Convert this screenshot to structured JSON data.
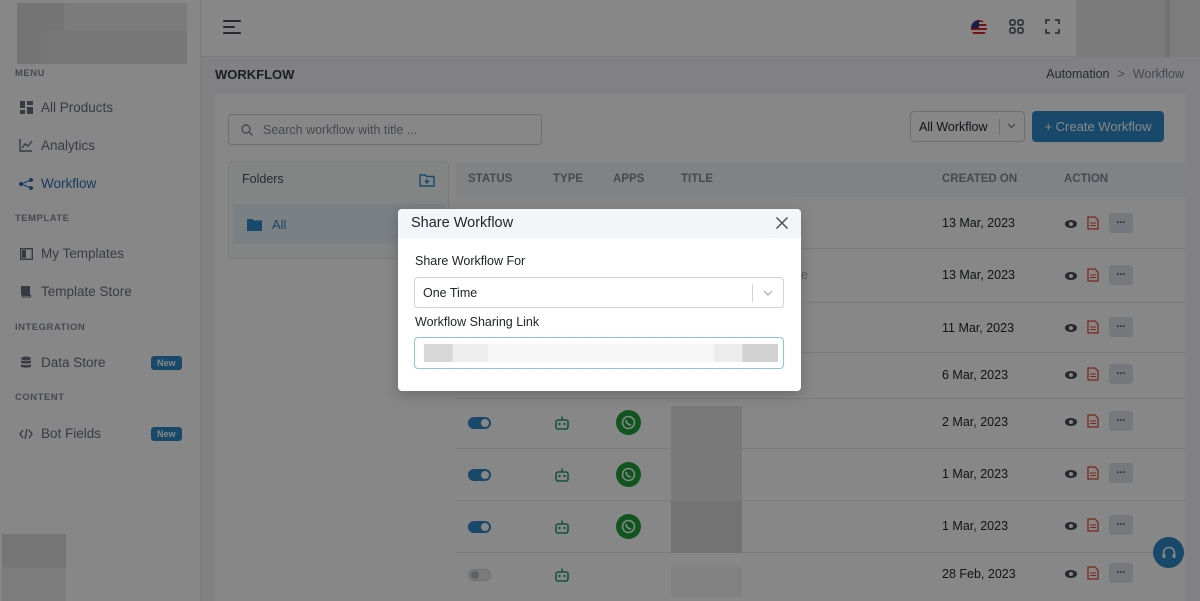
{
  "sidebar": {
    "sections": {
      "menu": "MENU",
      "template": "TEMPLATE",
      "integration": "INTEGRATION",
      "content": "CONTENT"
    },
    "items": [
      {
        "label": "All Products",
        "icon": "grid-icon"
      },
      {
        "label": "Analytics",
        "icon": "line-chart-icon"
      },
      {
        "label": "Workflow",
        "icon": "share-nodes-icon",
        "active": true
      },
      {
        "label": "My Templates",
        "icon": "layout-icon"
      },
      {
        "label": "Template Store",
        "icon": "book-icon"
      },
      {
        "label": "Data Store",
        "icon": "database-icon",
        "badge": "New"
      },
      {
        "label": "Bot Fields",
        "icon": "code-icon",
        "badge": "New"
      }
    ]
  },
  "header": {
    "page_title": "WORKFLOW",
    "breadcrumb": [
      "Automation",
      "Workflow"
    ],
    "breadcrumb_sep": ">"
  },
  "toolbar": {
    "search_placeholder": "Search workflow with title ...",
    "filter_value": "All Workflow",
    "create_label": "+ Create Workflow"
  },
  "folders": {
    "title": "Folders",
    "items": [
      "All"
    ]
  },
  "table": {
    "columns": [
      "STATUS",
      "TYPE",
      "APPS",
      "TITLE",
      "CREATED ON",
      "ACTION"
    ],
    "rows": [
      {
        "created_on": "13 Mar, 2023"
      },
      {
        "created_on": "13 Mar, 2023"
      },
      {
        "created_on": "11 Mar, 2023"
      },
      {
        "created_on": "6 Mar, 2023"
      },
      {
        "created_on": "2 Mar, 2023",
        "status": true,
        "app": "whatsapp"
      },
      {
        "created_on": "1 Mar, 2023",
        "status": true,
        "app": "whatsapp"
      },
      {
        "created_on": "1 Mar, 2023",
        "status": true,
        "app": "whatsapp"
      },
      {
        "created_on": "28 Feb, 2023",
        "status": false
      }
    ],
    "more_label": "..."
  },
  "modal": {
    "title": "Share Workflow",
    "share_for_label": "Share Workflow For",
    "share_for_value": "One Time",
    "link_label": "Workflow Sharing Link",
    "partial_title_fragment": "e"
  },
  "colors": {
    "primary": "#2e8bc9",
    "backdrop": "rgba(0,0,0,0.47)",
    "whatsapp": "#1fa03a",
    "bot": "#2a9d6f"
  }
}
